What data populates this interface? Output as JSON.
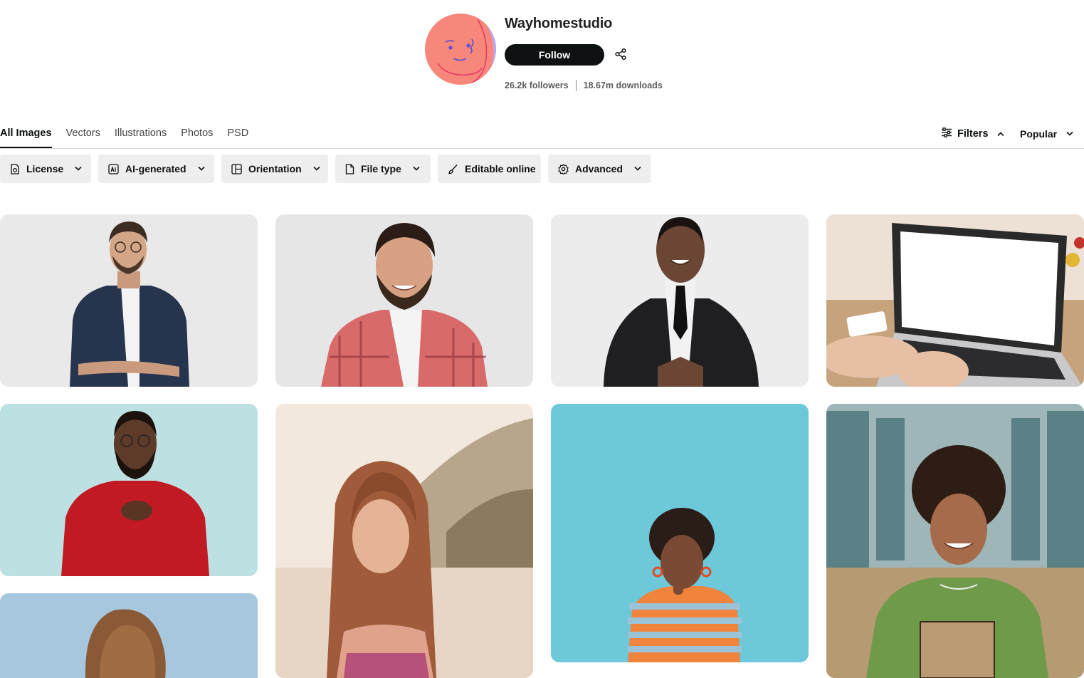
{
  "profile": {
    "name": "Wayhomestudio",
    "follow_label": "Follow",
    "followers": "26.2k followers",
    "downloads": "18.67m downloads"
  },
  "tabs": [
    {
      "label": "All Images",
      "active": true
    },
    {
      "label": "Vectors"
    },
    {
      "label": "Illustrations"
    },
    {
      "label": "Photos"
    },
    {
      "label": "PSD"
    }
  ],
  "toolbar": {
    "filters_label": "Filters",
    "sort_label": "Popular"
  },
  "filter_chips": [
    {
      "label": "License",
      "icon": "license-icon"
    },
    {
      "label": "AI-generated",
      "icon": "ai-generated-icon"
    },
    {
      "label": "Orientation",
      "icon": "orientation-icon"
    },
    {
      "label": "File type",
      "icon": "file-icon"
    },
    {
      "label": "Editable online",
      "icon": "brush-icon"
    },
    {
      "label": "Advanced",
      "icon": "gear-icon"
    }
  ],
  "images": [
    "man-in-glasses-navy-shirt-photo",
    "bearded-man-plaid-shirt-photo",
    "businessman-in-suit-photo",
    "laptop-blank-screen-photo",
    "man-in-red-sweater-photo",
    "girl-on-beach-photo",
    "thoughtful-woman-striped-top-photo",
    "woman-green-sweater-with-notebook-photo",
    "woman-long-hair-sky-photo"
  ],
  "colors": {
    "accent": "#0e1111",
    "chip_bg": "#eeeeee",
    "avatar_face": "#f7877a",
    "avatar_ring": "#b9a8f7"
  }
}
